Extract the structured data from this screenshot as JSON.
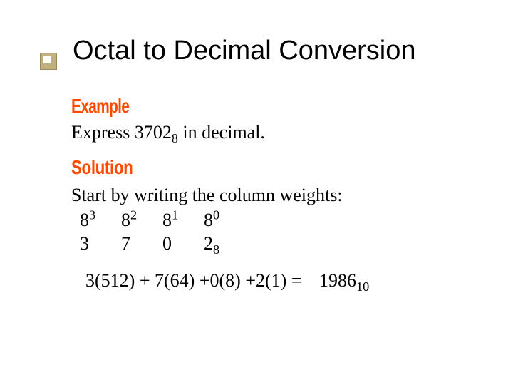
{
  "title": "Octal to Decimal Conversion",
  "labels": {
    "example": "Example",
    "solution": "Solution"
  },
  "problem": {
    "prefix": "Express ",
    "number": "3702",
    "base": "8",
    "suffix": " in decimal."
  },
  "step_text": "Start by writing the column weights:",
  "weights": {
    "base": "8",
    "exp3": "3",
    "exp2": "2",
    "exp1": "1",
    "exp0": "0"
  },
  "digits": {
    "d3": "3",
    "d2": "7",
    "d1": "0",
    "d0": "2",
    "d0_base": "8"
  },
  "product": {
    "t1a": "3(512)",
    "plus1": " + ",
    "t2": "7(64)",
    "plus2": " +",
    "t3": "0(8)",
    "plus3": " +",
    "t4": "2(1)",
    "eq": " = ",
    "result": "1986",
    "result_base": "10"
  }
}
